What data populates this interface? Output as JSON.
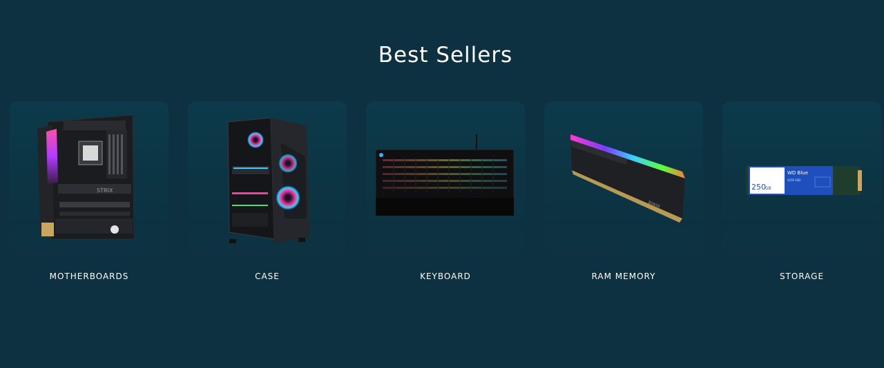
{
  "section": {
    "title": "Best Sellers"
  },
  "products": [
    {
      "label": "MOTHERBOARDS",
      "icon": "motherboard-image"
    },
    {
      "label": "CASE",
      "icon": "pc-case-image"
    },
    {
      "label": "KEYBOARD",
      "icon": "keyboard-image"
    },
    {
      "label": "RAM MEMORY",
      "icon": "ram-memory-image"
    },
    {
      "label": "STORAGE",
      "icon": "ssd-storage-image"
    }
  ],
  "ssd": {
    "brand": "WD Blue",
    "type": "SATA SSD",
    "capacity": "250",
    "unit": "GB"
  },
  "colors": {
    "background": "#0d3141",
    "card": "#0c3a4a",
    "text": "#ffffff"
  }
}
